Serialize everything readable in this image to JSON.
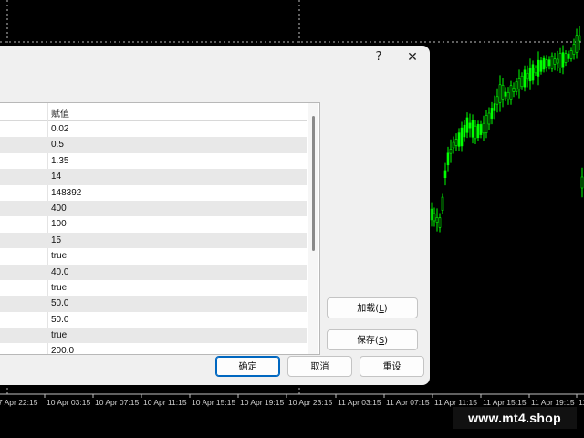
{
  "chart": {
    "time_axis_labels": [
      "7 Apr 22:15",
      "10 Apr 03:15",
      "10 Apr 07:15",
      "10 Apr 11:15",
      "10 Apr 15:15",
      "10 Apr 19:15",
      "10 Apr 23:15",
      "11 Apr 03:15",
      "11 Apr 07:15",
      "11 Apr 11:15",
      "11 Apr 15:15",
      "11 Apr 19:15",
      "11"
    ],
    "candle_color": "#00ff00",
    "grid_color": "#c0c0c0",
    "background": "#000000"
  },
  "dialog": {
    "help_label": "?",
    "close_label": "✕",
    "grid": {
      "value_header": "赋值",
      "values": [
        "0.02",
        "0.5",
        "1.35",
        "14",
        "148392",
        "400",
        "100",
        "15",
        "true",
        "40.0",
        "true",
        "50.0",
        "50.0",
        "true",
        "200.0"
      ]
    },
    "buttons": {
      "load": "加载(",
      "load_key": "L",
      "load_end": ")",
      "save": "保存(",
      "save_key": "S",
      "save_end": ")",
      "ok": "确定",
      "cancel": "取消",
      "reset": "重设"
    }
  },
  "watermark": "www.mt4.shop"
}
